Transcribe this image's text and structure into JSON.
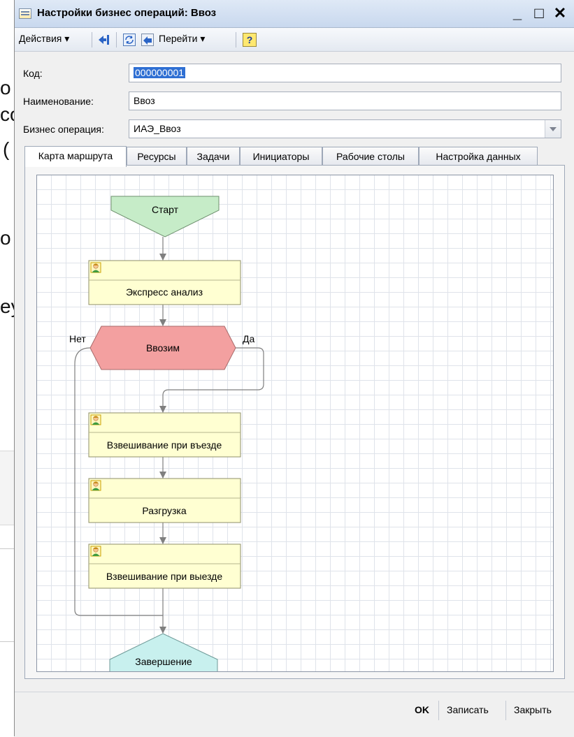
{
  "background_document": {
    "fragments": [
      "o",
      "co",
      "(",
      "o",
      "ey"
    ]
  },
  "window": {
    "title": "Настройки бизнес операций: Ввоз",
    "controls": {
      "minimize": "_",
      "maximize": "□",
      "close": "✕"
    }
  },
  "toolbar": {
    "actions_label": "Действия ▾",
    "goto_label": "Перейти ▾",
    "help_label": "?"
  },
  "form": {
    "code_label": "Код:",
    "code_value": "000000001",
    "name_label": "Наименование:",
    "name_value": "Ввоз",
    "operation_label": "Бизнес операция:",
    "operation_value": "ИАЭ_Ввоз"
  },
  "tabs": [
    {
      "label": "Карта маршрута",
      "active": true
    },
    {
      "label": "Ресурсы",
      "active": false
    },
    {
      "label": "Задачи",
      "active": false
    },
    {
      "label": "Инициаторы",
      "active": false
    },
    {
      "label": "Рабочие столы",
      "active": false
    },
    {
      "label": "Настройка данных",
      "active": false
    }
  ],
  "route_map": {
    "start": "Старт",
    "steps": [
      "Экспресс анализ",
      "Взвешивание при въезде",
      "Разгрузка",
      "Взвешивание при выезде"
    ],
    "decision": {
      "label": "Ввозим",
      "no_label": "Нет",
      "yes_label": "Да"
    },
    "end": "Завершение",
    "colors": {
      "start": "#c6ecc8",
      "task": "#ffffd2",
      "decision": "#f3a0a0",
      "end": "#c8f0ee",
      "arrow": "#7f7f7f"
    }
  },
  "footer": {
    "ok_label": "OK",
    "save_label": "Записать",
    "close_label": "Закрыть"
  }
}
